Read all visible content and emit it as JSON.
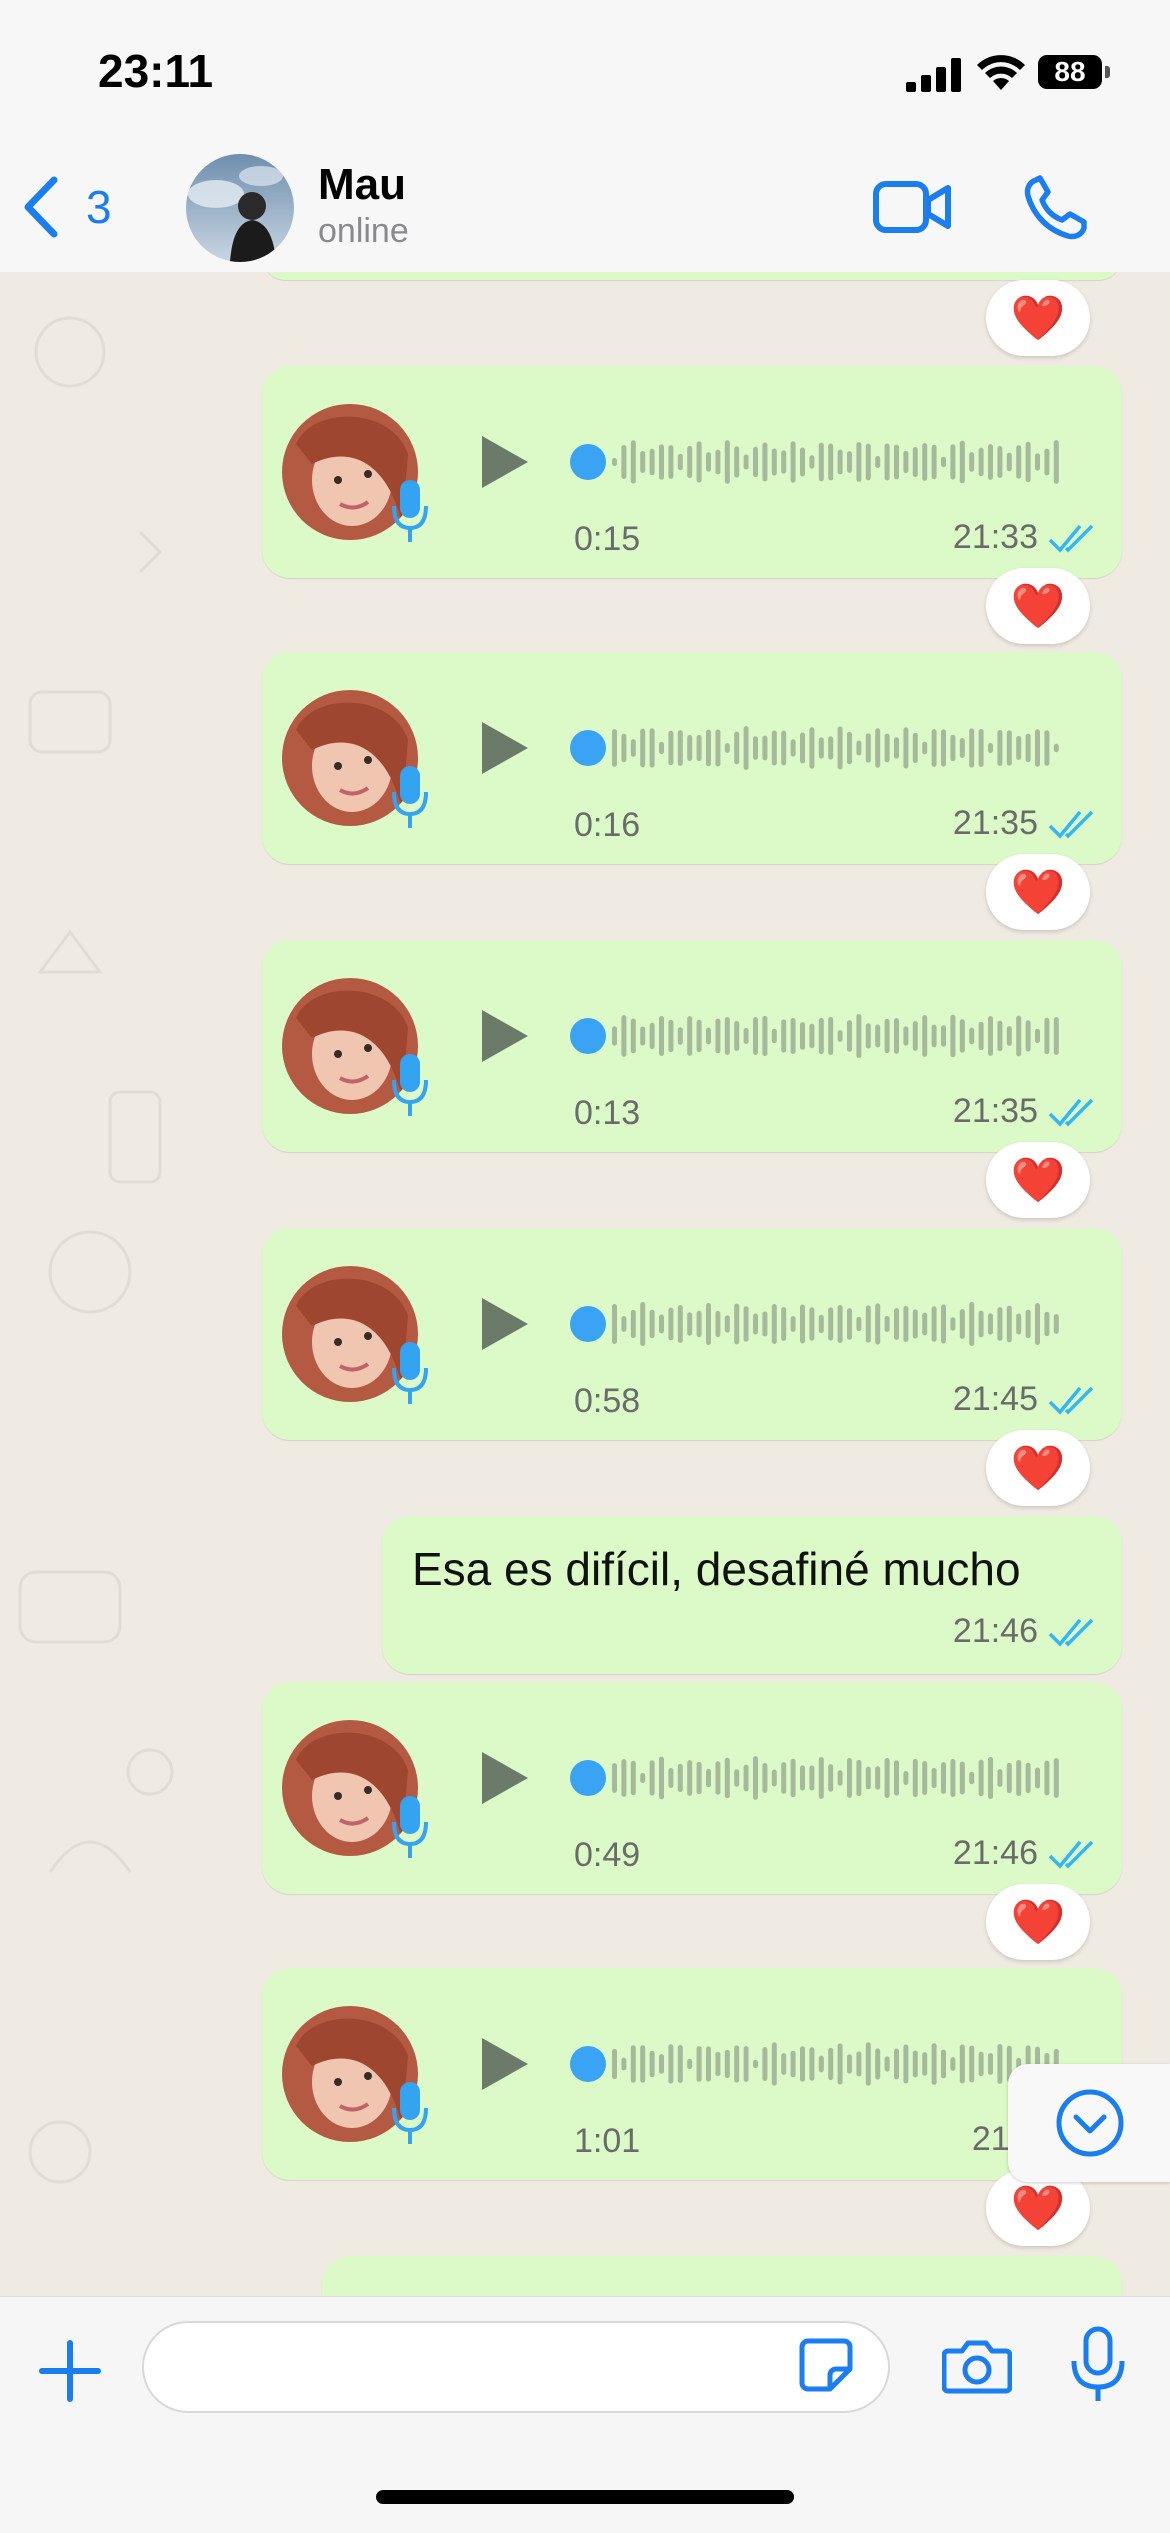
{
  "status_bar": {
    "time": "23:11",
    "battery": "88"
  },
  "header": {
    "back_count": "3",
    "contact_name": "Mau",
    "contact_status": "online"
  },
  "messages": [
    {
      "type": "voice",
      "duration": "0:15",
      "time": "21:33",
      "reaction": "❤️"
    },
    {
      "type": "voice",
      "duration": "0:16",
      "time": "21:35",
      "reaction": "❤️"
    },
    {
      "type": "voice",
      "duration": "0:13",
      "time": "21:35",
      "reaction": "❤️"
    },
    {
      "type": "voice",
      "duration": "0:58",
      "time": "21:45",
      "reaction": "❤️"
    },
    {
      "type": "text",
      "text": "Esa es difícil, desafiné mucho",
      "time": "21:46"
    },
    {
      "type": "voice",
      "duration": "0:49",
      "time": "21:46",
      "reaction": "❤️"
    },
    {
      "type": "voice",
      "duration": "1:01",
      "time": "21:4",
      "reaction": "❤️"
    }
  ],
  "top_reaction": "❤️",
  "colors": {
    "accent": "#1a7df0",
    "bubble": "#dbfac7",
    "chat_bg": "#efeae2",
    "read_ticks": "#34b7f1"
  },
  "input": {
    "placeholder": ""
  }
}
